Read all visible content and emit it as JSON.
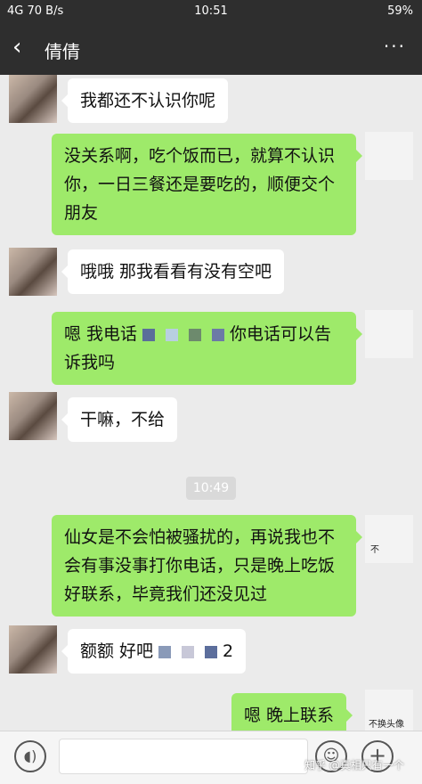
{
  "status": {
    "left": "4G 70 B/s",
    "time": "10:51",
    "battery": "59%"
  },
  "header": {
    "back_icon": "chevron-left-icon",
    "title": "倩倩",
    "more": "···"
  },
  "messages": [
    {
      "side": "left",
      "text": "我都还不认识你呢"
    },
    {
      "side": "right",
      "text": "没关系啊，吃个饭而已，就算不认识你，一日三餐还是要吃的，顺便交个朋友"
    },
    {
      "side": "left",
      "text": "哦哦 那我看看有没有空吧"
    },
    {
      "side": "right",
      "text_a": "嗯 我电话",
      "text_b": "你电话可以告诉我吗"
    },
    {
      "side": "left",
      "text": "干嘛，不给"
    },
    {
      "side": "right",
      "text": "仙女是不会怕被骚扰的，再说我也不会有事没事打你电话，只是晚上吃饭好联系，毕竟我们还没见过"
    },
    {
      "side": "left",
      "text_a": "额额 好吧",
      "text_b": "2"
    },
    {
      "side": "right",
      "text": "嗯 晚上联系"
    }
  ],
  "timestamp": "10:49",
  "avatar_tags": {
    "small": "不",
    "bottom": "不换头像"
  },
  "watermark": "知乎 @真相只有一个"
}
